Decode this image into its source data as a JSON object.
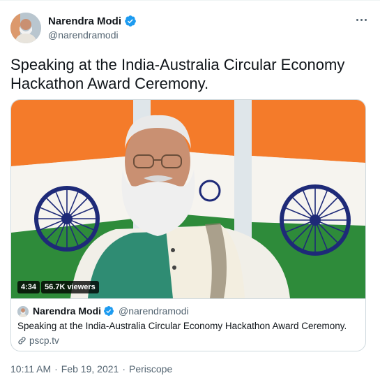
{
  "author": {
    "name": "Narendra Modi",
    "handle": "@narendramodi"
  },
  "tweet": {
    "text": "Speaking at the India-Australia Circular Economy Hackathon Award Ceremony."
  },
  "video": {
    "duration": "4:34",
    "viewers": "56.7K viewers"
  },
  "card": {
    "name": "Narendra Modi",
    "handle": "@narendramodi",
    "text": "Speaking at the India-Australia Circular Economy Hackathon Award Ceremony.",
    "link": "pscp.tv"
  },
  "meta": {
    "time": "10:11 AM",
    "date": "Feb 19, 2021",
    "source": "Periscope",
    "separator": "·"
  },
  "colors": {
    "verified": "#1d9bf0",
    "saffron": "#f47b2a",
    "green": "#2e8b3a",
    "chakra": "#1e2a78"
  }
}
